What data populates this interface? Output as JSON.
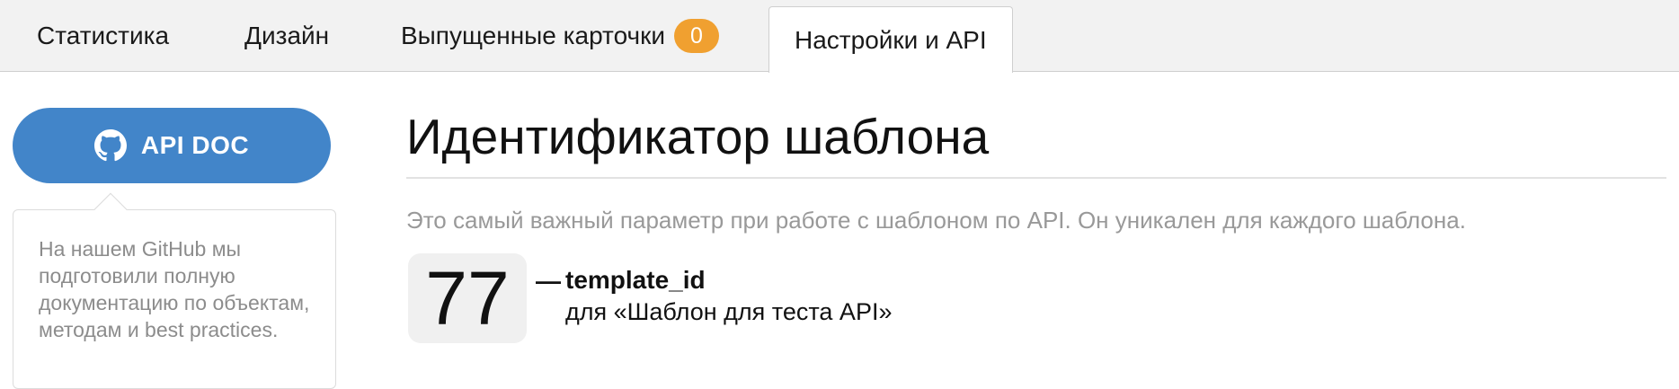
{
  "tabs": [
    {
      "label": "Статистика"
    },
    {
      "label": "Дизайн"
    },
    {
      "label": "Выпущенные карточки",
      "badge": "0"
    },
    {
      "label": "Настройки и API",
      "active": true
    }
  ],
  "sidebar": {
    "api_button_label": "API DOC",
    "api_button_icon": "github-icon",
    "note": "На нашем GitHub мы подготовили полную документацию по объектам, методам и best practices."
  },
  "main": {
    "heading": "Идентификатор шаблона",
    "description": "Это самый важный параметр при работе с шаблоном по API. Он уникален для каждого шаблона.",
    "template_id_value": "77",
    "dash": "—",
    "param_name": "template_id",
    "param_for": "для «Шаблон для теста API»"
  },
  "colors": {
    "accent": "#4285c9",
    "badge": "#f0a030",
    "tabbar_bg": "#f2f2f2"
  }
}
